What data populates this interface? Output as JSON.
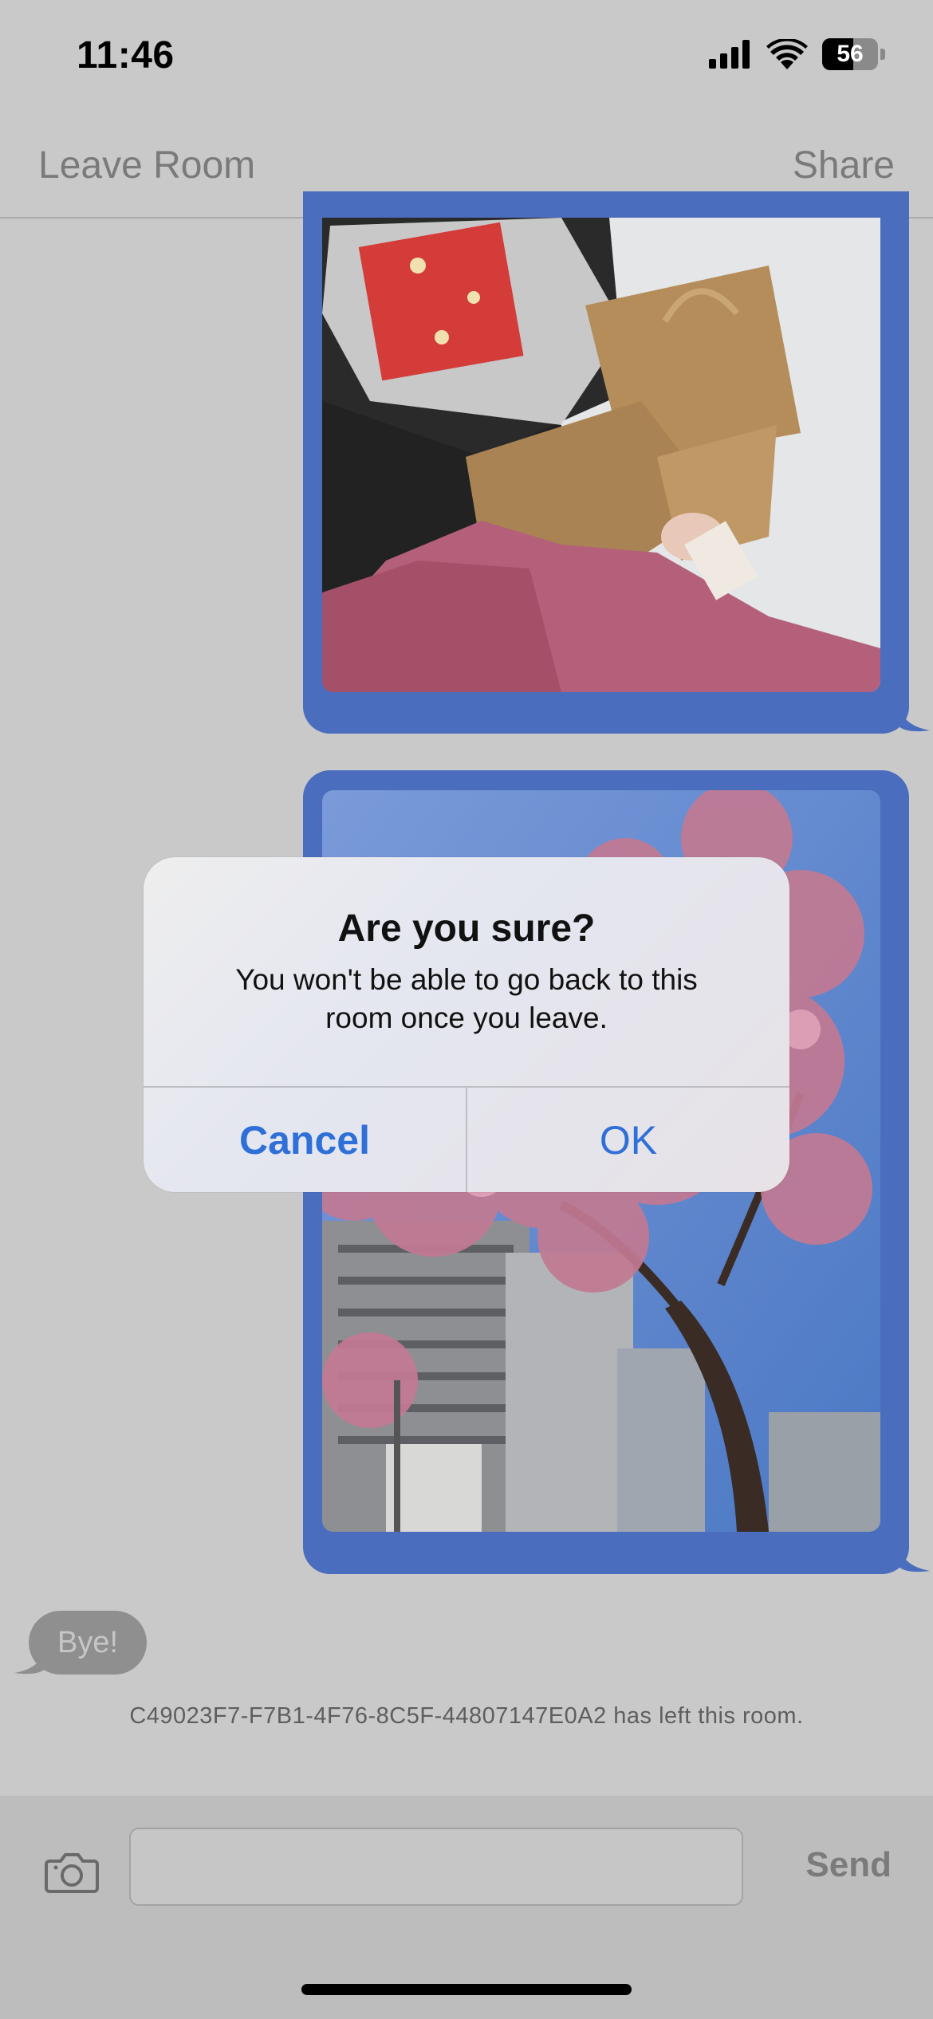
{
  "status_bar": {
    "time": "11:46",
    "battery_level": "56"
  },
  "nav": {
    "leave_label": "Leave Room",
    "share_label": "Share"
  },
  "messages": {
    "bye_text": "Bye!",
    "system_text": "C49023F7-F7B1-4F76-8C5F-44807147E0A2 has left this room."
  },
  "composer": {
    "input_value": "",
    "input_placeholder": "",
    "send_label": "Send"
  },
  "alert": {
    "title": "Are you sure?",
    "message": "You won't be able to go back to this room once you leave.",
    "cancel_label": "Cancel",
    "ok_label": "OK"
  },
  "icons": [
    "signal-icon",
    "wifi-icon",
    "battery-icon",
    "camera-icon"
  ],
  "colors": {
    "bubble_blue": "#4a6dbd",
    "alert_button_blue": "#2f6fd8",
    "background": "#c9c9c9"
  }
}
